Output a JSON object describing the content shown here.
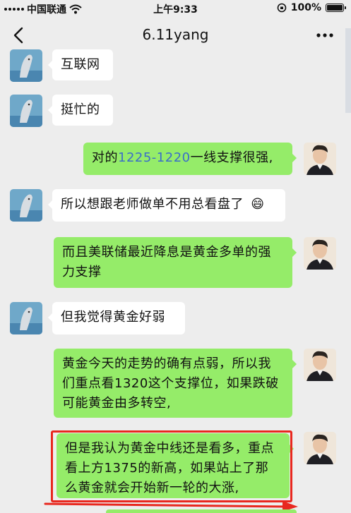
{
  "status_bar": {
    "carrier": "中国联通",
    "time": "上午9:33",
    "battery": "100%"
  },
  "nav": {
    "title": "6.11yang"
  },
  "messages": [
    {
      "side": "in",
      "text": "互联网"
    },
    {
      "side": "in",
      "text": "挺忙的"
    },
    {
      "side": "out",
      "pre": "对的",
      "link": "1225-1220",
      "post": "一线支撑很强,"
    },
    {
      "side": "in",
      "text": "所以想跟老师做单不用总看盘了",
      "emoji": "😄"
    },
    {
      "side": "out",
      "text": "而且美联储最近降息是黄金多单的强力支撑"
    },
    {
      "side": "in",
      "text": "但我觉得黄金好弱"
    },
    {
      "side": "out",
      "text": "黄金今天的走势的确有点弱，所以我们重点看1320这个支撑位，如果跌破可能黄金由多转空,"
    },
    {
      "side": "out",
      "text": "但是我认为黄金中线还是看多，重点看上方1375的新高，如果站上了那么黄金就会开始新一轮的大涨,",
      "highlighted": true
    }
  ],
  "colors": {
    "background": "#ededed",
    "incoming_bubble": "#ffffff",
    "outgoing_bubble": "#95ec69",
    "highlight": "#e8281f",
    "link": "#3b6ec9"
  }
}
